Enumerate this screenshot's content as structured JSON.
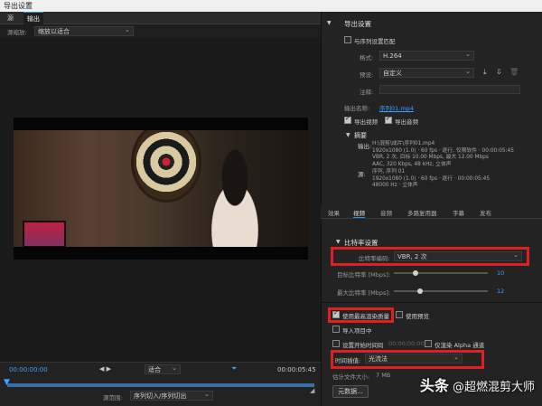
{
  "window": {
    "title": "导出设置"
  },
  "left_tabs": [
    "源",
    "输出"
  ],
  "source_scaling": {
    "label": "源缩放:",
    "value": "缩放以适合"
  },
  "timeline": {
    "in_tc": "00:00:00:00",
    "out_tc": "00:00:05:45",
    "fit": "适合",
    "range_label": "源范围:",
    "range_value": "序列切入/序列切出"
  },
  "export": {
    "section": "导出设置",
    "match_sequence": "与序列设置匹配",
    "format_label": "格式:",
    "format_value": "H.264",
    "preset_label": "预设:",
    "preset_value": "自定义",
    "comment_label": "注释:",
    "output_name_label": "输出名称:",
    "output_name_value": "序列01.mp4",
    "export_video": "导出视频",
    "export_audio": "导出音频",
    "summary_title": "摘要",
    "output_label": "输出:",
    "output_lines": [
      "H:\\混剪\\成片\\序列01.mp4",
      "1920x1080 (1.0) · 60 fps · 逐行, 仅限软件 · 00:00:05:45",
      "VBR, 2 次, 目标 10.00 Mbps, 最大 12.00 Mbps",
      "AAC, 320 Kbps, 48 kHz, 立体声"
    ],
    "source_label": "源:",
    "source_lines": [
      "序列, 序列 01",
      "1920x1080 (1.0) · 60 fps · 逐行 · 00:00:05:45",
      "48000 Hz · 立体声"
    ]
  },
  "tabs": [
    "效果",
    "视频",
    "音频",
    "多路复用器",
    "字幕",
    "发布"
  ],
  "active_tab": "视频",
  "bitrate": {
    "section": "比特率设置",
    "encoding_label": "比特率编码:",
    "encoding_value": "VBR, 2 次",
    "target_label": "目标比特率 [Mbps]:",
    "target_value": "10",
    "max_label": "最大比特率 [Mbps]:",
    "max_value": "12"
  },
  "options": {
    "max_render_quality": "使用最高渲染质量",
    "use_preview": "使用预览",
    "import_project": "导入项目中",
    "set_start_tc": "设置开始时间码",
    "start_tc_value": "00;00;00;00",
    "render_alpha": "仅渲染 Alpha 通道",
    "time_interp_label": "时间插值:",
    "time_interp_value": "光流法",
    "est_size_label": "估计文件大小:",
    "est_size_value": "7 MB",
    "metadata_btn": "元数据..."
  },
  "watermark": {
    "prefix": "头条",
    "text": "@超燃混剪大师"
  },
  "colors": {
    "accent": "#2f8fe6",
    "highlight_box": "#e02020"
  }
}
